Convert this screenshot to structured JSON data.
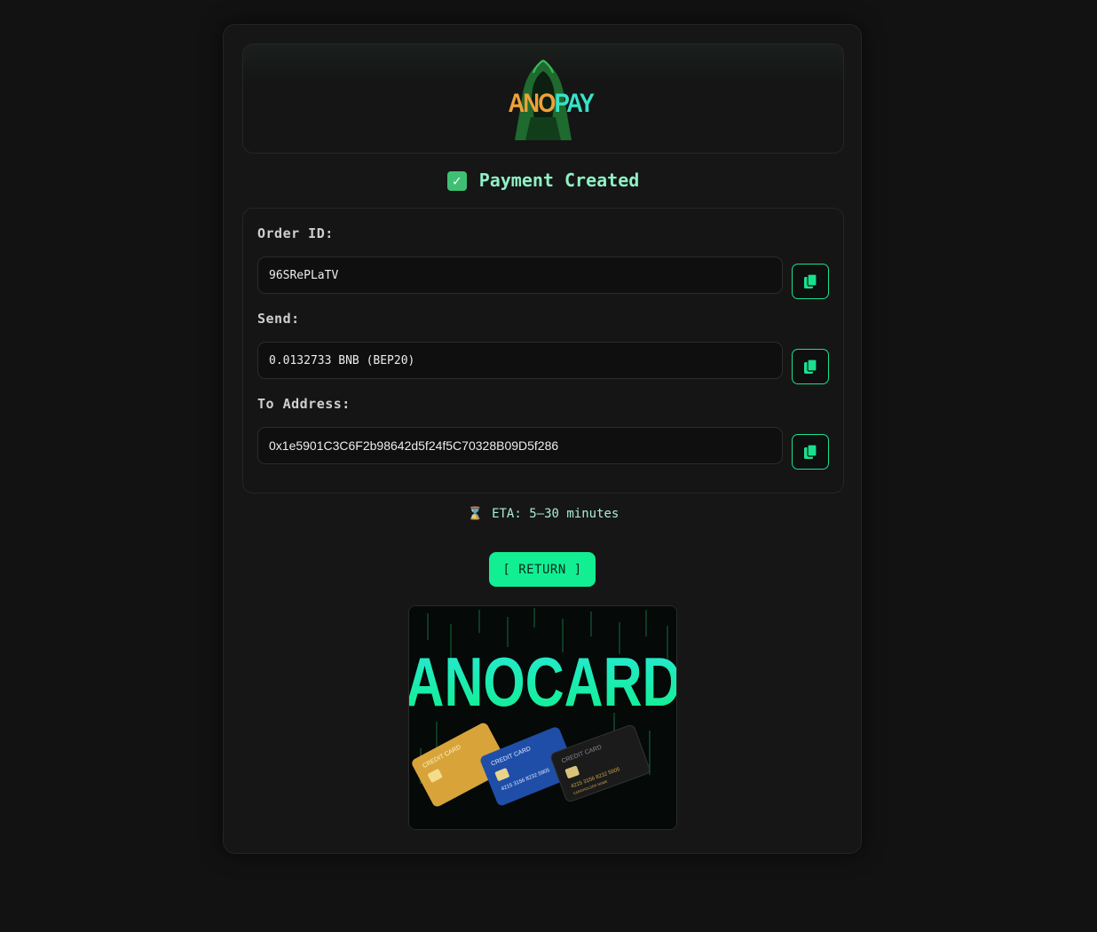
{
  "logo": {
    "part1": "ANO",
    "part2": "PAY"
  },
  "title": "Payment Created",
  "fields": [
    {
      "label": "Order ID:",
      "value": "96SRePLaTV"
    },
    {
      "label": "Send:",
      "value": "0.0132733 BNB (BEP20)"
    },
    {
      "label": "To Address:",
      "value": "0x1e5901C3C6F2b98642d5f24f5C70328B09D5f286"
    }
  ],
  "eta": "ETA: 5–30 minutes",
  "return_label": "[ RETURN ]",
  "banner": {
    "title": "ANOCARD",
    "card_label": "CREDIT CARD",
    "card_number": "4215 3156 8232 5905",
    "card_holder": "CARDHOLDER NAME"
  },
  "colors": {
    "accent": "#12ef93",
    "title": "#8ff0c4",
    "background": "#121212"
  },
  "icons": [
    "check-icon",
    "copy-icon",
    "hourglass-icon"
  ]
}
